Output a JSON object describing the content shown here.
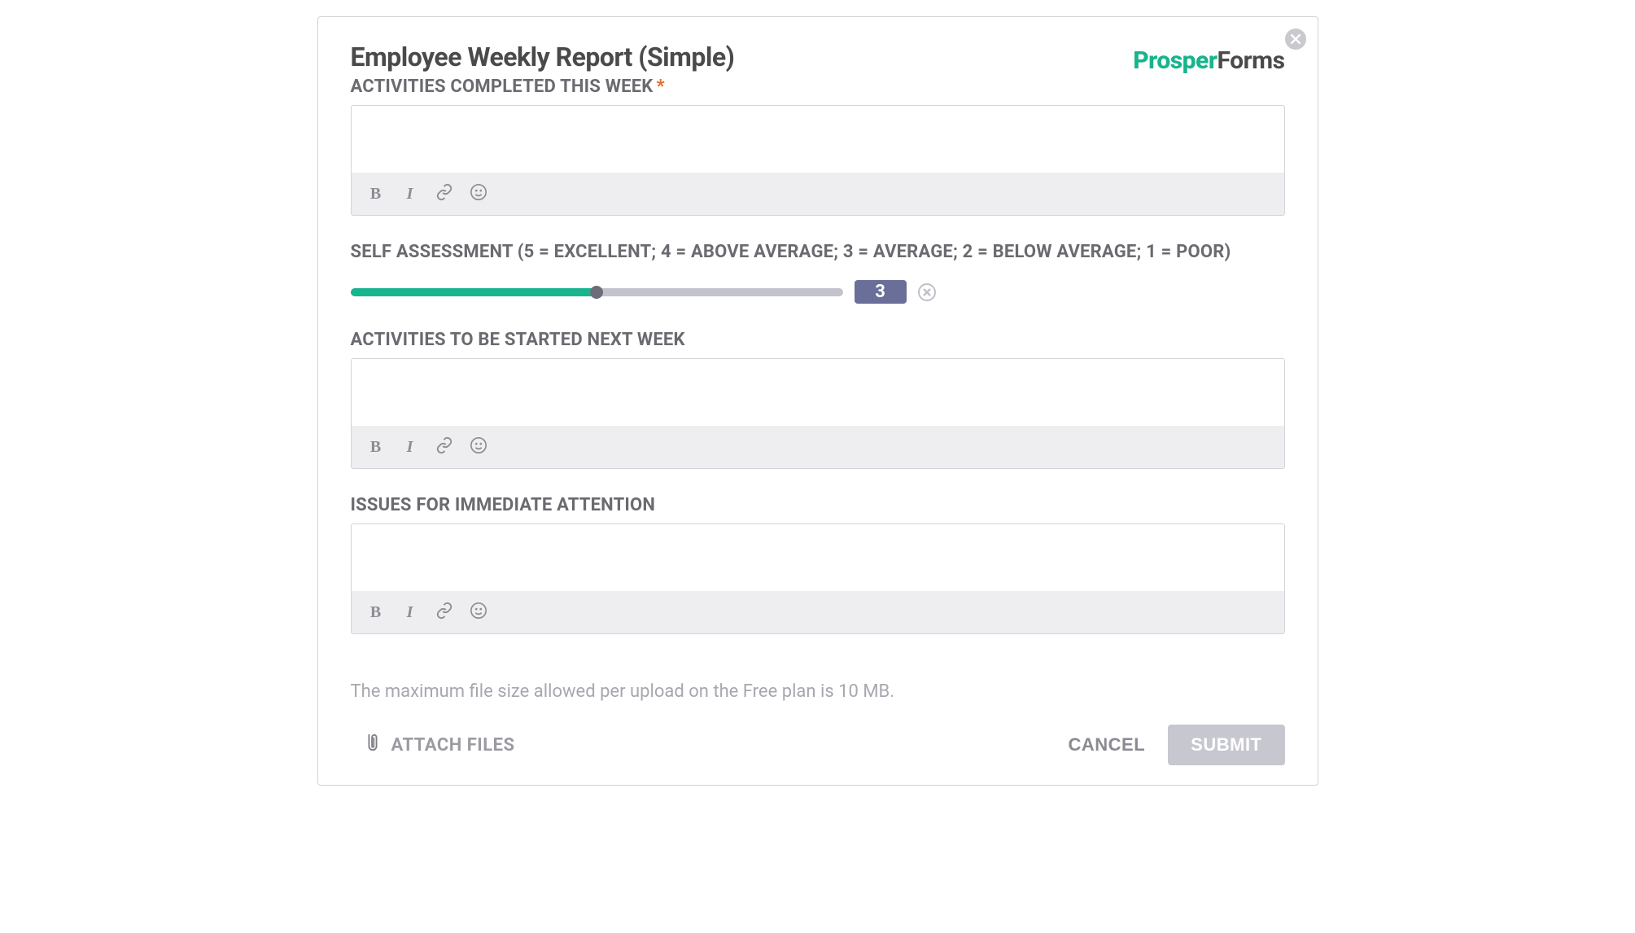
{
  "header": {
    "title": "Employee Weekly Report (Simple)",
    "logo_prosper": "Prosper",
    "logo_forms": "Forms"
  },
  "fields": {
    "activities_completed": {
      "label": "ACTIVITIES COMPLETED THIS WEEK",
      "required_mark": "*",
      "value": ""
    },
    "self_assessment": {
      "label": "SELF ASSESSMENT (5 = EXCELLENT; 4 = ABOVE AVERAGE; 3 = AVERAGE; 2 = BELOW AVERAGE; 1 = POOR)",
      "value": 3,
      "min": 1,
      "max": 5,
      "display": "3",
      "fill_percent": 50
    },
    "activities_next": {
      "label": "ACTIVITIES TO BE STARTED NEXT WEEK",
      "value": ""
    },
    "issues": {
      "label": "ISSUES FOR IMMEDIATE ATTENTION",
      "value": ""
    }
  },
  "toolbar": {
    "bold": "B",
    "italic": "I"
  },
  "footer": {
    "file_hint": "The maximum file size allowed per upload on the Free plan is 10 MB.",
    "attach_label": "ATTACH FILES",
    "cancel_label": "CANCEL",
    "submit_label": "SUBMIT"
  },
  "colors": {
    "accent_green": "#18b48d",
    "badge_blue": "#6a6f99",
    "required_orange": "#e46a2a"
  }
}
